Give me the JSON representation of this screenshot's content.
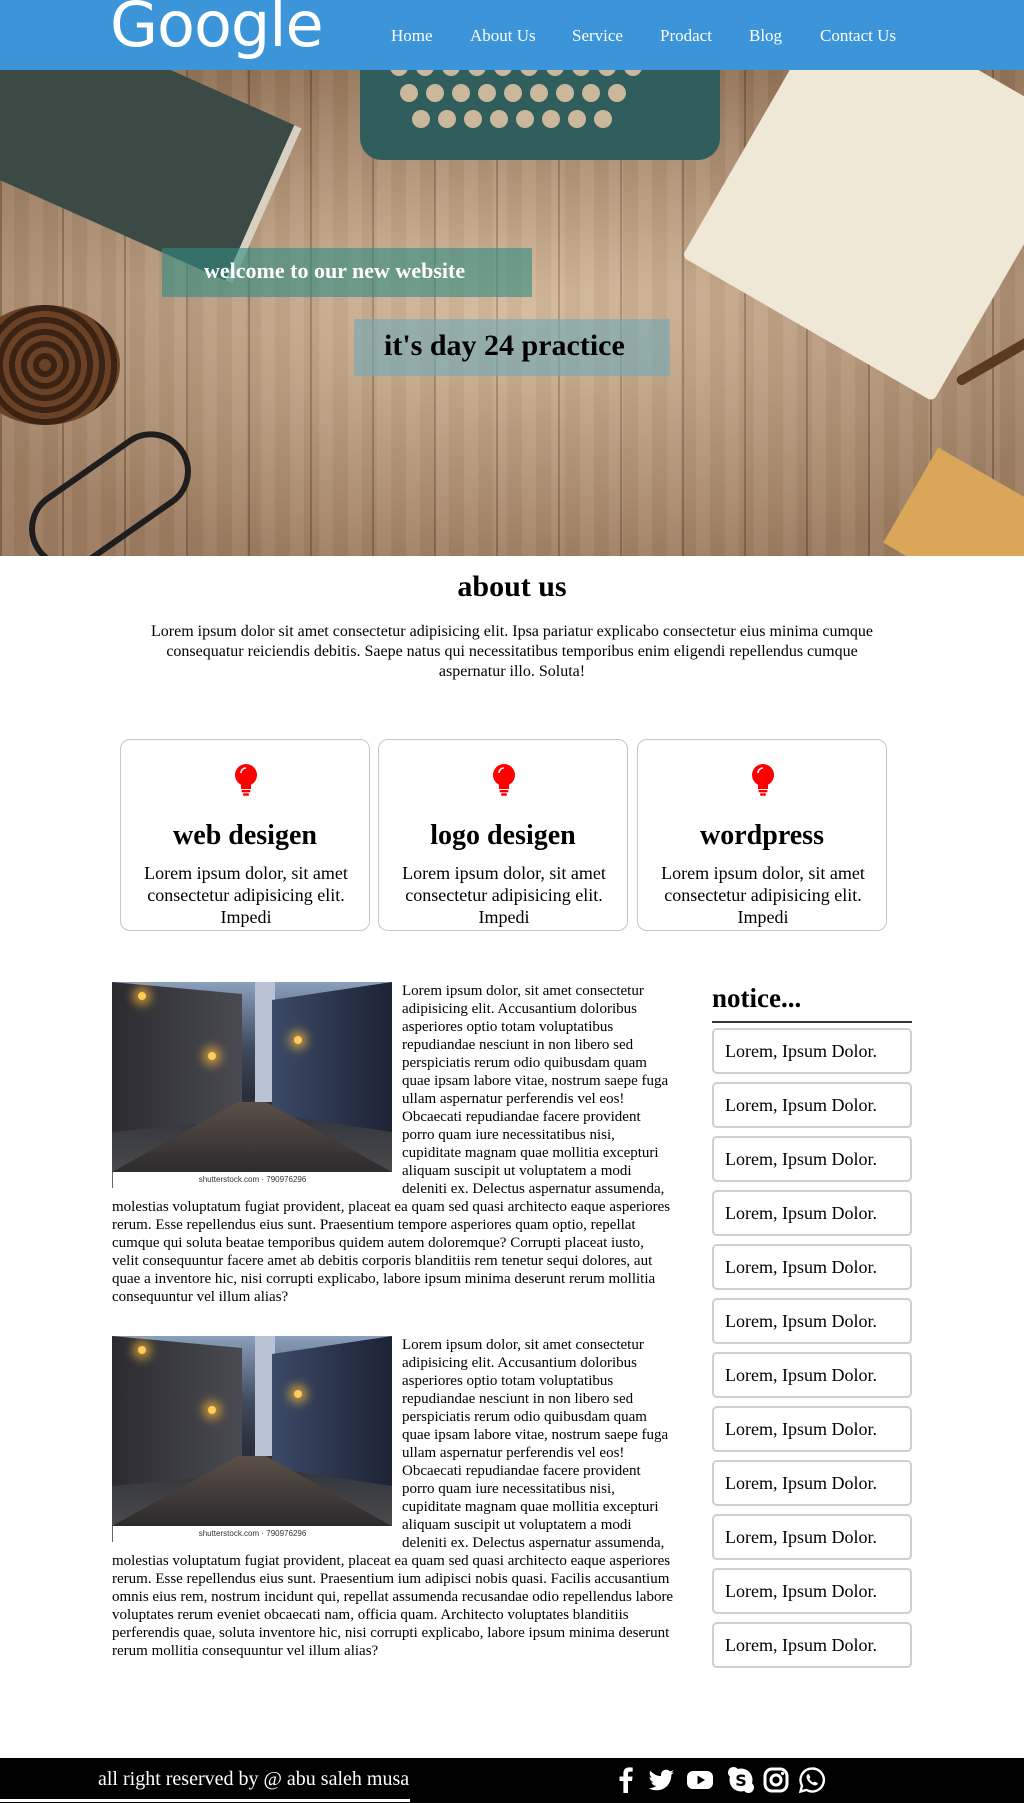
{
  "header": {
    "logo": "Google",
    "nav": [
      {
        "label": "Home"
      },
      {
        "label": "About Us"
      },
      {
        "label": "Service"
      },
      {
        "label": "Prodact"
      },
      {
        "label": "Blog"
      },
      {
        "label": "Contact Us"
      }
    ]
  },
  "hero": {
    "welcome": "welcome to our new website",
    "practice": "it's day 24 practice"
  },
  "about": {
    "title": "about us",
    "text": "Lorem ipsum dolor sit amet consectetur adipisicing elit. Ipsa pariatur explicabo consectetur eius minima cumque consequatur reiciendis debitis. Saepe natus qui necessitatibus temporibus enim eligendi repellendus cumque aspernatur illo. Soluta!"
  },
  "cards": [
    {
      "icon": "lightbulb-icon",
      "title": "web desigen",
      "text": "Lorem ipsum dolor, sit amet consectetur adipisicing elit. Impedi"
    },
    {
      "icon": "lightbulb-icon",
      "title": "logo desigen",
      "text": "Lorem ipsum dolor, sit amet consectetur adipisicing elit. Impedi"
    },
    {
      "icon": "lightbulb-icon",
      "title": "wordpress",
      "text": "Lorem ipsum dolor, sit amet consectetur adipisicing elit. Impedi"
    }
  ],
  "articles": [
    {
      "image_credit": "shutterstock.com · 790976296",
      "text": "Lorem ipsum dolor, sit amet consectetur adipisicing elit. Accusantium doloribus asperiores optio totam voluptatibus repudiandae nesciunt in non libero sed perspiciatis rerum odio quibusdam quam quae ipsam labore vitae, nostrum saepe fuga ullam aspernatur perferendis vel eos! Obcaecati repudiandae facere provident porro quam iure necessitatibus nisi, cupiditate magnam quae mollitia excepturi aliquam suscipit ut voluptatem a modi deleniti ex. Delectus aspernatur assumenda, molestias voluptatum fugiat provident, placeat ea quam sed quasi architecto eaque asperiores rerum. Esse repellendus eius sunt. Praesentium tempore asperiores quam optio, repellat cumque qui soluta beatae temporibus quidem autem doloremque? Corrupti placeat iusto, velit consequuntur facere amet ab debitis corporis blanditiis rem tenetur sequi dolores, aut quae a inventore hic, nisi corrupti explicabo, labore ipsum minima deserunt rerum mollitia consequuntur vel illum alias?"
    },
    {
      "image_credit": "shutterstock.com · 790976296",
      "text": "Lorem ipsum dolor, sit amet consectetur adipisicing elit. Accusantium doloribus asperiores optio totam voluptatibus repudiandae nesciunt in non libero sed perspiciatis rerum odio quibusdam quam quae ipsam labore vitae, nostrum saepe fuga ullam aspernatur perferendis vel eos! Obcaecati repudiandae facere provident porro quam iure necessitatibus nisi, cupiditate magnam quae mollitia excepturi aliquam suscipit ut voluptatem a modi deleniti ex. Delectus aspernatur assumenda, molestias voluptatum fugiat provident, placeat ea quam sed quasi architecto eaque asperiores rerum. Esse repellendus eius sunt. Praesentium ium adipisci nobis quasi. Facilis accusantium omnis eius rem, nostrum incidunt qui, repellat assumenda recusandae odio repellendus labore voluptates rerum eveniet obcaecati nam, officia quam. Architecto voluptates blanditiis perferendis quae, soluta inventore hic, nisi corrupti explicabo, labore ipsum minima deserunt rerum mollitia consequuntur vel illum alias?"
    }
  ],
  "notice": {
    "title": "notice...",
    "items": [
      "Lorem, Ipsum Dolor.",
      "Lorem, Ipsum Dolor.",
      "Lorem, Ipsum Dolor.",
      "Lorem, Ipsum Dolor.",
      "Lorem, Ipsum Dolor.",
      "Lorem, Ipsum Dolor.",
      "Lorem, Ipsum Dolor.",
      "Lorem, Ipsum Dolor.",
      "Lorem, Ipsum Dolor.",
      "Lorem, Ipsum Dolor.",
      "Lorem, Ipsum Dolor.",
      "Lorem, Ipsum Dolor."
    ]
  },
  "footer": {
    "copyright": "all right reserved by @ abu saleh musa",
    "social_icons": [
      "facebook-icon",
      "twitter-icon",
      "youtube-icon",
      "skype-icon",
      "instagram-icon",
      "whatsapp-icon"
    ]
  },
  "colors": {
    "header_bg": "#3b95d8",
    "bulb": "#ff0000",
    "footer_bg": "#000000"
  }
}
